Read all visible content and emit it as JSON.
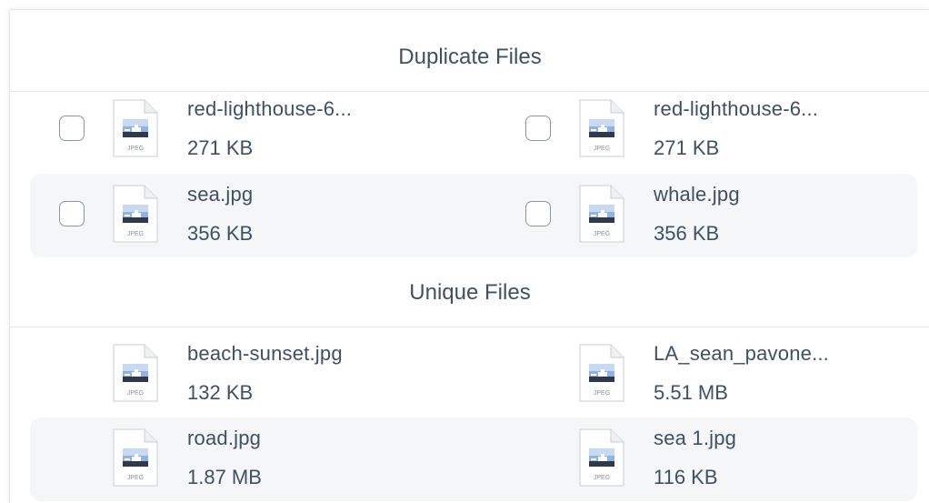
{
  "duplicates": {
    "title": "Duplicate Files",
    "rows": [
      {
        "left": {
          "name": "red-lighthouse-6...",
          "size": "271 KB",
          "icon": "jpeg-file-icon",
          "checked": false
        },
        "right": {
          "name": "red-lighthouse-6...",
          "size": "271 KB",
          "icon": "jpeg-file-icon",
          "checked": false
        }
      },
      {
        "left": {
          "name": "sea.jpg",
          "size": "356 KB",
          "icon": "jpeg-file-icon",
          "checked": false
        },
        "right": {
          "name": "whale.jpg",
          "size": "356 KB",
          "icon": "jpeg-file-icon",
          "checked": false
        }
      }
    ]
  },
  "unique": {
    "title": "Unique Files",
    "rows": [
      {
        "left": {
          "name": "beach-sunset.jpg",
          "size": "132 KB",
          "icon": "jpeg-file-icon"
        },
        "right": {
          "name": "LA_sean_pavone...",
          "size": "5.51 MB",
          "icon": "jpeg-file-icon"
        }
      },
      {
        "left": {
          "name": "road.jpg",
          "size": "1.87 MB",
          "icon": "jpeg-file-icon"
        },
        "right": {
          "name": "sea 1.jpg",
          "size": "116 KB",
          "icon": "jpeg-file-icon"
        }
      }
    ]
  },
  "icon_label": "JPEG",
  "colors": {
    "text": "#3f5065",
    "row_alt": "#f5f6f8",
    "divider": "#e3e6ea"
  }
}
